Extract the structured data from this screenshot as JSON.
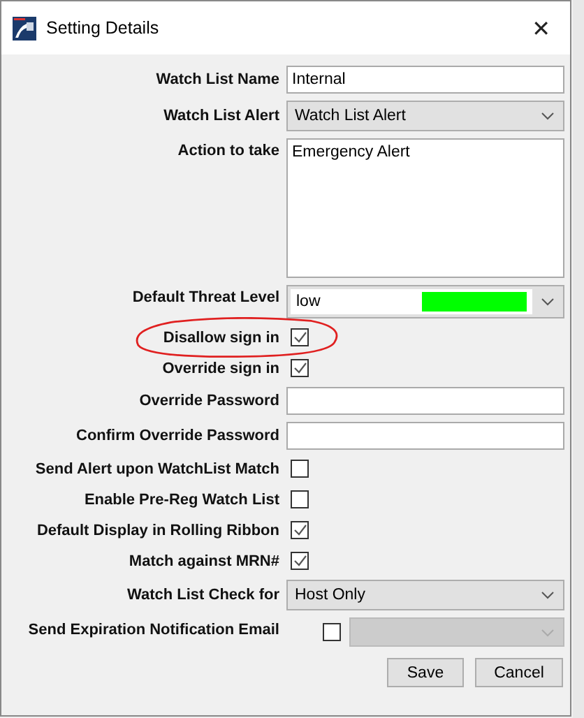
{
  "window": {
    "title": "Setting Details",
    "close": "✕"
  },
  "fields": [
    {
      "kind": "text",
      "label": "Watch List Name",
      "value": "Internal"
    },
    {
      "kind": "select",
      "label": "Watch List Alert",
      "value": "Watch List Alert"
    },
    {
      "kind": "textarea",
      "label": "Action to take",
      "value": "Emergency Alert"
    },
    {
      "kind": "threat",
      "label": "Default Threat Level",
      "value": "low",
      "color": "#00ff00"
    },
    {
      "kind": "checkbox",
      "label": "Disallow sign in",
      "checked": true
    },
    {
      "kind": "checkbox",
      "label": "Override sign in",
      "checked": true
    },
    {
      "kind": "text",
      "label": "Override Password"
    },
    {
      "kind": "text",
      "label": "Confirm Override Password"
    },
    {
      "kind": "checkbox",
      "label": "Send Alert upon WatchList Match",
      "checked": false
    },
    {
      "kind": "checkbox",
      "label": "Enable Pre-Reg Watch List",
      "checked": false
    },
    {
      "kind": "checkbox",
      "label": "Default Display in Rolling Ribbon",
      "checked": true
    },
    {
      "kind": "checkbox",
      "label": "Match against MRN#",
      "checked": true
    },
    {
      "kind": "select",
      "label": "Watch List Check for",
      "value": "Host Only"
    },
    {
      "kind": "checkselect",
      "label": "Send Expiration Notification Email",
      "checked": false,
      "disabled": true
    }
  ],
  "buttons": [
    "Save",
    "Cancel"
  ]
}
